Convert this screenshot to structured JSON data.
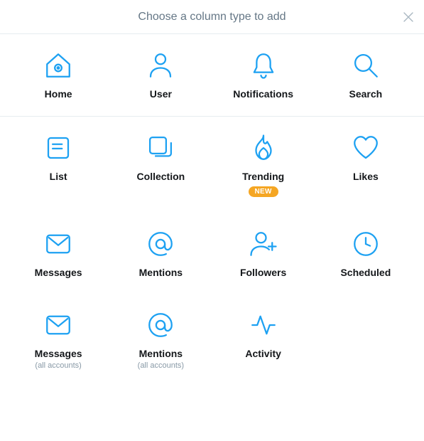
{
  "header": {
    "title": "Choose a column type to add"
  },
  "primary": [
    {
      "label": "Home"
    },
    {
      "label": "User"
    },
    {
      "label": "Notifications"
    },
    {
      "label": "Search"
    }
  ],
  "secondary": [
    {
      "label": "List"
    },
    {
      "label": "Collection"
    },
    {
      "label": "Trending",
      "badge": "NEW"
    },
    {
      "label": "Likes"
    },
    {
      "label": "Messages"
    },
    {
      "label": "Mentions"
    },
    {
      "label": "Followers"
    },
    {
      "label": "Scheduled"
    },
    {
      "label": "Messages",
      "sub": "(all accounts)"
    },
    {
      "label": "Mentions",
      "sub": "(all accounts)"
    },
    {
      "label": "Activity"
    }
  ]
}
